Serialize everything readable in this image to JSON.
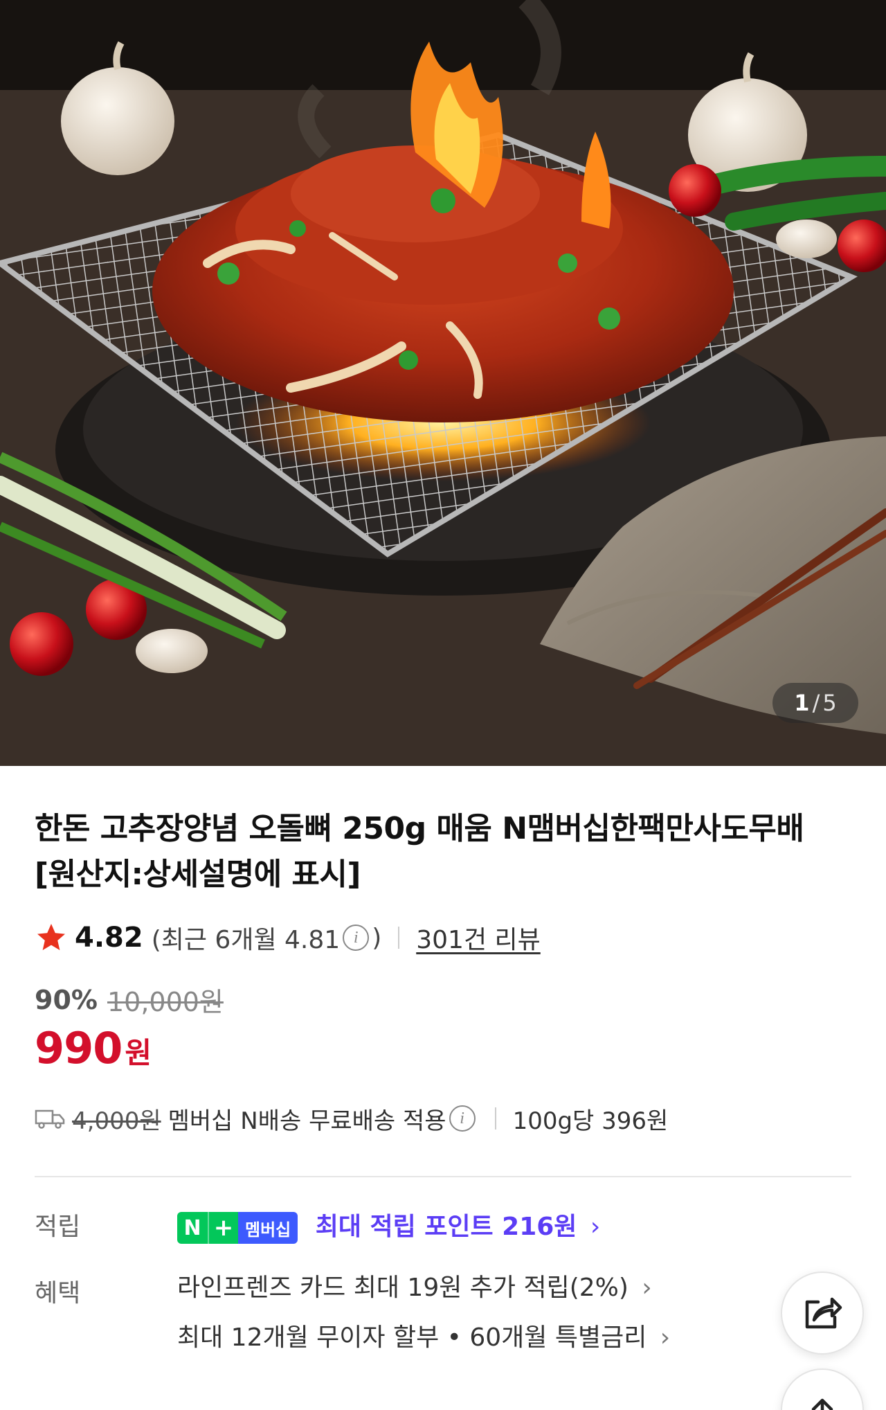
{
  "gallery": {
    "image_alt_icon": "grilled-spicy-pork-cartilage-photo",
    "current": "1",
    "separator": "/",
    "total": "5"
  },
  "product": {
    "title_line1": "한돈 고추장양념 오돌뼈 250g 매움 N맴버십한팩만사도무배",
    "title_line2": "[원산지:상세설명에 표시]"
  },
  "rating": {
    "score": "4.82",
    "recent_prefix": "(최근 6개월 4.81",
    "info_glyph": "i",
    "recent_suffix": ")",
    "review_count": "301건 리뷰"
  },
  "pricing": {
    "discount_rate": "90%",
    "original_price": "10,000원",
    "sale_price": "990",
    "currency": "원"
  },
  "shipping": {
    "original_fee": "4,000원",
    "description": "멤버십 N배송 무료배송 적용",
    "info_glyph": "i",
    "unit_price": "100g당 396원"
  },
  "benefits": {
    "points_label": "적립",
    "badge_n": "N",
    "badge_plus": "+",
    "badge_membership": "멤버십",
    "points_text": "최대 적립 포인트 216원",
    "chevron": "›",
    "perks_label": "혜택",
    "perk_card": "라인프렌즈 카드 최대 19원 추가 적립(2%)",
    "perk_installment": "최대 12개월 무이자 할부 • 60개월 특별금리"
  },
  "colors": {
    "sale_red": "#d30f2b",
    "naver_green": "#03c75a",
    "membership_blue": "#3d5afe",
    "point_purple": "#5b3df5",
    "star_red": "#e8321e"
  }
}
